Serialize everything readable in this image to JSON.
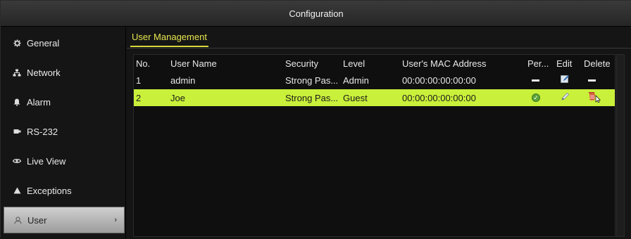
{
  "window": {
    "title": "Configuration"
  },
  "sidebar": {
    "items": [
      {
        "label": "General",
        "icon": "gear-icon",
        "active": false
      },
      {
        "label": "Network",
        "icon": "network-icon",
        "active": false
      },
      {
        "label": "Alarm",
        "icon": "bell-icon",
        "active": false
      },
      {
        "label": "RS-232",
        "icon": "serial-port-icon",
        "active": false
      },
      {
        "label": "Live View",
        "icon": "eye-icon",
        "active": false
      },
      {
        "label": "Exceptions",
        "icon": "warning-icon",
        "active": false
      },
      {
        "label": "User",
        "icon": "user-icon",
        "active": true
      }
    ]
  },
  "main": {
    "tab": "User Management",
    "table": {
      "headers": {
        "no": "No.",
        "name": "User Name",
        "security": "Security",
        "level": "Level",
        "mac": "User's MAC Address",
        "permission": "Per...",
        "edit": "Edit",
        "delete": "Delete"
      },
      "rows": [
        {
          "no": "1",
          "name": "admin",
          "security": "Strong Pas...",
          "level": "Admin",
          "mac": "00:00:00:00:00:00",
          "permission": "dash",
          "edit": "edit-icon",
          "delete": "dash",
          "selected": false
        },
        {
          "no": "2",
          "name": "Joe",
          "security": "Strong Pas...",
          "level": "Guest",
          "mac": "00:00:00:00:00:00",
          "permission": "check-icon",
          "edit": "edit-icon",
          "delete": "delete-icon",
          "selected": true
        }
      ]
    }
  },
  "colors": {
    "accent_tab": "#d8d83a",
    "selected_row": "#c9f03a"
  }
}
